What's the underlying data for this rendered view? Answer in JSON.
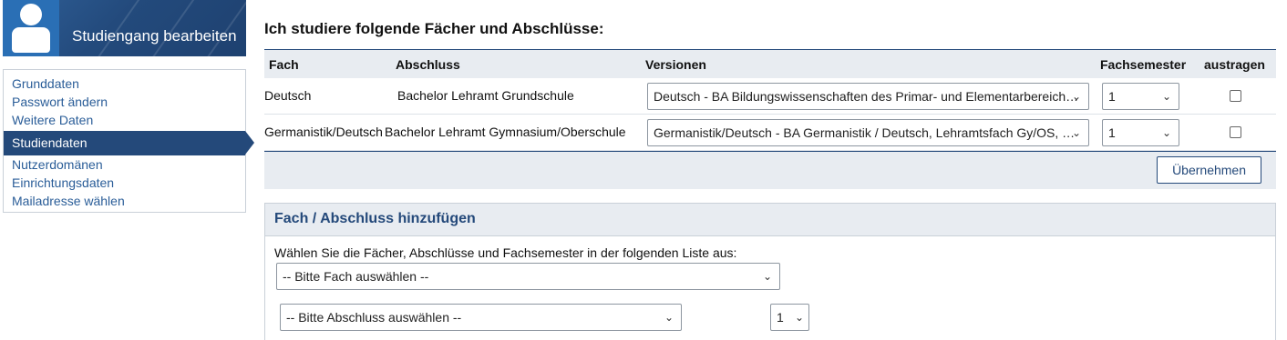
{
  "sidebar": {
    "title": "Studiengang bearbeiten",
    "items": [
      {
        "label": "Grunddaten",
        "active": false
      },
      {
        "label": "Passwort ändern",
        "active": false
      },
      {
        "label": "Weitere Daten",
        "active": false
      },
      {
        "label": "Studiendaten",
        "active": true
      },
      {
        "label": "Nutzerdomänen",
        "active": false
      },
      {
        "label": "Einrichtungsdaten",
        "active": false
      },
      {
        "label": "Mailadresse wählen",
        "active": false
      }
    ]
  },
  "main": {
    "title": "Ich studiere folgende Fächer und Abschlüsse:",
    "columns": {
      "fach": "Fach",
      "abschluss": "Abschluss",
      "versionen": "Versionen",
      "fachsemester": "Fachsemester",
      "austragen": "austragen"
    },
    "rows": [
      {
        "fach": "Deutsch",
        "abschluss": "Bachelor Lehramt Grundschule",
        "version": "Deutsch - BA Bildungswissenschaften des Primar- und Elementarbereich…",
        "semester": "1"
      },
      {
        "fach": "Germanistik/Deutsch",
        "abschluss": "Bachelor Lehramt Gymnasium/Oberschule",
        "version": "Germanistik/Deutsch - BA Germanistik / Deutsch, Lehramtsfach Gy/OS, …",
        "semester": "1"
      }
    ],
    "submit_label": "Übernehmen"
  },
  "add_panel": {
    "title": "Fach / Abschluss hinzufügen",
    "hint": "Wählen Sie die Fächer, Abschlüsse und Fachsemester in der folgenden Liste aus:",
    "fach_select": "-- Bitte Fach auswählen --",
    "abschluss_select": "-- Bitte Abschluss auswählen --",
    "semester_select": "1"
  },
  "icons": {
    "chevron": "chevron-down-icon",
    "avatar": "user-avatar-icon"
  },
  "colors": {
    "primary": "#24497a",
    "link": "#2a5d98",
    "header_bg": "#e8ecf1"
  }
}
